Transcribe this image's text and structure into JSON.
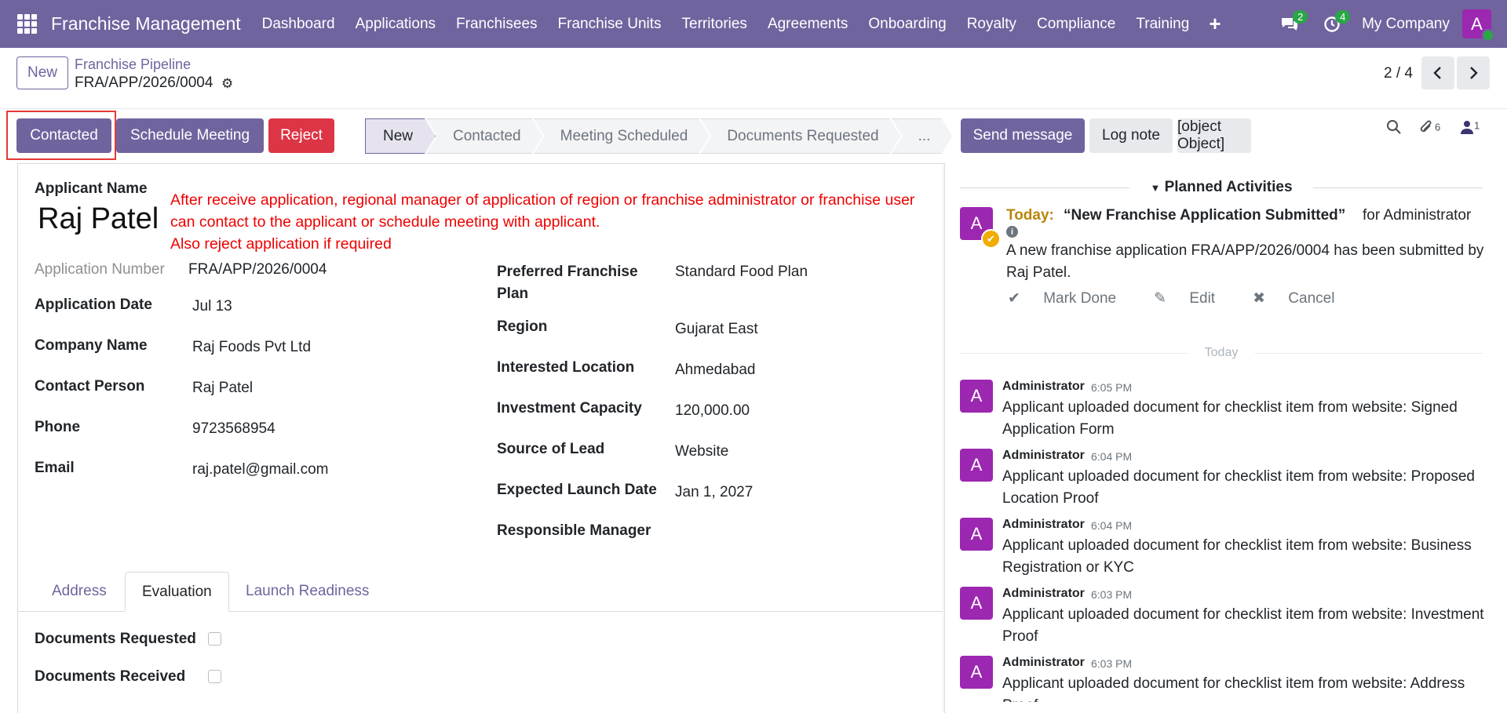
{
  "navbar": {
    "brand": "Franchise Management",
    "items": [
      "Dashboard",
      "Applications",
      "Franchisees",
      "Franchise Units",
      "Territories",
      "Agreements",
      "Onboarding",
      "Royalty",
      "Compliance",
      "Training"
    ],
    "plus": "+",
    "messages_count": "2",
    "activities_count": "4",
    "company": "My Company",
    "avatar_letter": "A"
  },
  "control": {
    "new_label": "New",
    "breadcrumb": "Franchise Pipeline",
    "record": "FRA/APP/2026/0004",
    "pager": "2 / 4"
  },
  "actions": {
    "contacted": "Contacted",
    "schedule": "Schedule Meeting",
    "reject": "Reject"
  },
  "stages": [
    "New",
    "Contacted",
    "Meeting Scheduled",
    "Documents Requested",
    "..."
  ],
  "form": {
    "applicant_label": "Applicant Name",
    "applicant_name": "Raj Patel",
    "annotation": [
      "After receive application, regional manager of application of region or franchise administrator or franchise user",
      "can contact to the applicant or schedule meeting with applicant.",
      "Also reject application if required"
    ],
    "left_fields": [
      {
        "label": "Application Number",
        "value": "FRA/APP/2026/0004"
      },
      {
        "label": "Application Date",
        "value": "Jul 13"
      },
      {
        "label": "Company Name",
        "value": "Raj Foods Pvt Ltd"
      },
      {
        "label": "Contact Person",
        "value": "Raj Patel"
      },
      {
        "label": "Phone",
        "value": "9723568954"
      },
      {
        "label": "Email",
        "value": "raj.patel@gmail.com"
      }
    ],
    "right_fields": [
      {
        "label": "Preferred Franchise Plan",
        "value": "Standard Food Plan"
      },
      {
        "label": "Region",
        "value": "Gujarat East"
      },
      {
        "label": "Interested Location",
        "value": "Ahmedabad"
      },
      {
        "label": "Investment Capacity",
        "value": "120,000.00"
      },
      {
        "label": "Source of Lead",
        "value": "Website"
      },
      {
        "label": "Expected Launch Date",
        "value": "Jan 1, 2027"
      },
      {
        "label": "Responsible Manager",
        "value": ""
      }
    ],
    "tabs": [
      "Address",
      "Evaluation",
      "Launch Readiness"
    ],
    "checks": [
      {
        "label": "Documents Requested",
        "checked": false
      },
      {
        "label": "Documents Received",
        "checked": false
      }
    ]
  },
  "chatter": {
    "send_message": "Send message",
    "log_note": "Log note",
    "activity": {
      "when": "Today:",
      "title": "“New Franchise Application Submitted”",
      "for": "for Administrator",
      "desc": "A new franchise application FRA/APP/2026/0004 has been submitted by Raj Patel.",
      "mark_done": "Mark Done",
      "edit": "Edit",
      "cancel": "Cancel"
    },
    "attachments_count": "6",
    "followers_count": "1",
    "planned_title": "Planned Activities",
    "today_label": "Today",
    "messages": [
      {
        "author": "Administrator",
        "time": "6:05 PM",
        "body": "Applicant uploaded document for checklist item from website: Signed Application Form"
      },
      {
        "author": "Administrator",
        "time": "6:04 PM",
        "body": "Applicant uploaded document for checklist item from website: Proposed Location Proof"
      },
      {
        "author": "Administrator",
        "time": "6:04 PM",
        "body": "Applicant uploaded document for checklist item from website: Business Registration or KYC"
      },
      {
        "author": "Administrator",
        "time": "6:03 PM",
        "body": "Applicant uploaded document for checklist item from website: Investment Proof"
      },
      {
        "author": "Administrator",
        "time": "6:03 PM",
        "body": "Applicant uploaded document for checklist item from website: Address Proof"
      }
    ]
  },
  "colors": {
    "brand": "#71639e",
    "danger": "#dc3545",
    "annotation": "#e00000",
    "avatar": "#9c27b0"
  }
}
